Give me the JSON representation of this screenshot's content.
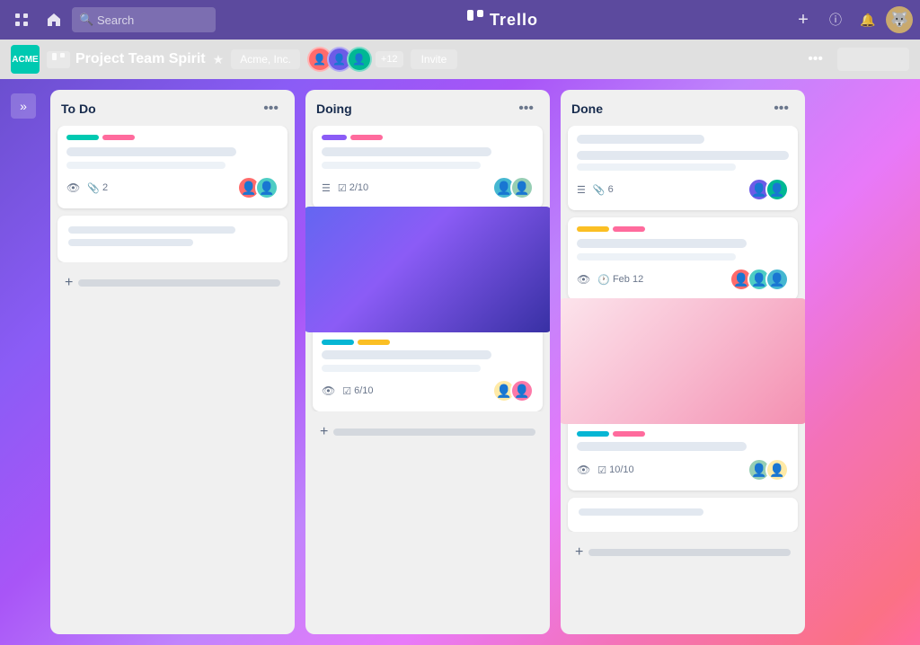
{
  "app": {
    "name": "Trello",
    "logo_symbol": "⊞"
  },
  "nav": {
    "home_icon": "⊞",
    "house_icon": "⌂",
    "search_placeholder": "Search",
    "add_label": "+",
    "info_label": "ⓘ",
    "bell_label": "🔔",
    "avatar_label": "🐺"
  },
  "board": {
    "acme_label": "ACME",
    "type_badge": "⊞⊞",
    "title": "Project Team Spirit",
    "star_icon": "★",
    "workspace_label": "Acme, Inc.",
    "plus_count": "+12",
    "invite_label": "Invite",
    "more_icon": "•••",
    "collapse_icon": "»"
  },
  "lists": [
    {
      "id": "todo",
      "title": "To Do",
      "cards": [
        {
          "id": "todo-1",
          "has_labels": true,
          "labels": [
            "cyan",
            "pink"
          ],
          "has_image": false,
          "meta_eye": true,
          "meta_clip": "2",
          "avatars": [
            "av-1",
            "av-2"
          ]
        },
        {
          "id": "todo-2",
          "has_labels": false,
          "is_placeholder": true
        }
      ]
    },
    {
      "id": "doing",
      "title": "Doing",
      "cards": [
        {
          "id": "doing-1",
          "has_labels": true,
          "labels": [
            "purple",
            "pink"
          ],
          "has_image": false,
          "meta_list": true,
          "meta_check": "2/10",
          "avatars": [
            "av-3",
            "av-4"
          ]
        },
        {
          "id": "doing-2",
          "has_labels": true,
          "labels": [
            "cyan",
            "yellow"
          ],
          "has_image": true,
          "image_type": "blue-gradient",
          "meta_eye": true,
          "meta_check": "6/10",
          "avatars": [
            "av-5",
            "av-6"
          ]
        }
      ]
    },
    {
      "id": "done",
      "title": "Done",
      "cards": [
        {
          "id": "done-1",
          "has_labels": false,
          "is_multi_line": true,
          "meta_list": true,
          "meta_clip": "6",
          "avatars": [
            "av-7",
            "av-8"
          ]
        },
        {
          "id": "done-2",
          "has_labels": true,
          "labels": [
            "yellow",
            "pink"
          ],
          "meta_eye": true,
          "meta_date": "Feb 12",
          "avatars": [
            "av-1",
            "av-2",
            "av-3"
          ]
        },
        {
          "id": "done-3",
          "has_labels": true,
          "labels": [
            "teal",
            "pink"
          ],
          "has_image": true,
          "image_type": "pink-gradient",
          "meta_eye": true,
          "meta_check": "10/10",
          "avatars": [
            "av-4",
            "av-5"
          ]
        },
        {
          "id": "done-4",
          "is_placeholder": true
        }
      ]
    }
  ]
}
